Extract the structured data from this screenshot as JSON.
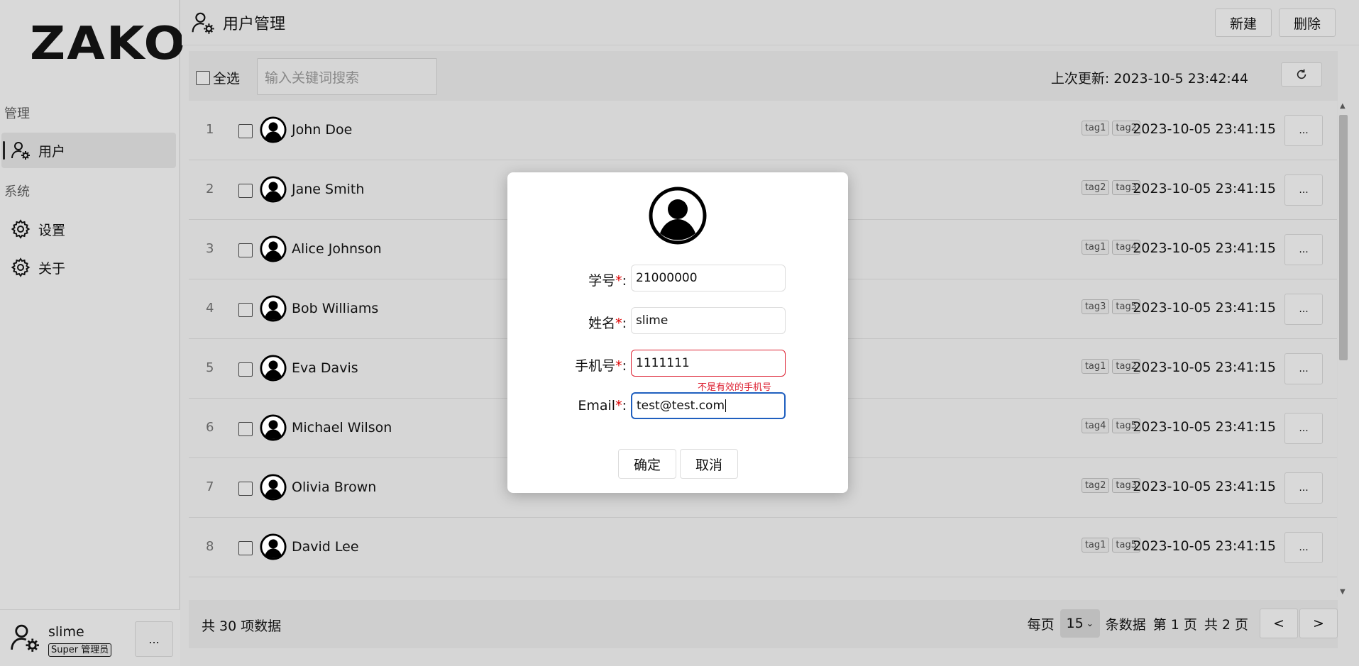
{
  "logo": "ZAKO",
  "sidebar": {
    "sections": [
      {
        "title": "管理",
        "items": [
          {
            "label": "用户",
            "icon": "user-gear-icon",
            "active": true
          }
        ]
      },
      {
        "title": "系统",
        "items": [
          {
            "label": "设置",
            "icon": "gear-icon"
          },
          {
            "label": "关于",
            "icon": "gear-icon"
          }
        ]
      }
    ],
    "user": {
      "name": "slime",
      "role": "Super 管理员",
      "more": "..."
    }
  },
  "header": {
    "title": "用户管理",
    "new_label": "新建",
    "delete_label": "删除"
  },
  "toolbar": {
    "select_all": "全选",
    "search_placeholder": "输入关键词搜索",
    "last_updated": "上次更新: 2023-10-5 23:42:44"
  },
  "rows": [
    {
      "index": "1",
      "name": "John Doe",
      "tags": [
        "tag1",
        "tag2"
      ],
      "date": "2023-10-05 23:41:15"
    },
    {
      "index": "2",
      "name": "Jane Smith",
      "tags": [
        "tag2",
        "tag3"
      ],
      "date": "2023-10-05 23:41:15"
    },
    {
      "index": "3",
      "name": "Alice Johnson",
      "tags": [
        "tag1",
        "tag4"
      ],
      "date": "2023-10-05 23:41:15"
    },
    {
      "index": "4",
      "name": "Bob Williams",
      "tags": [
        "tag3",
        "tag5"
      ],
      "date": "2023-10-05 23:41:15"
    },
    {
      "index": "5",
      "name": "Eva Davis",
      "tags": [
        "tag1",
        "tag2"
      ],
      "date": "2023-10-05 23:41:15"
    },
    {
      "index": "6",
      "name": "Michael Wilson",
      "tags": [
        "tag4",
        "tag5"
      ],
      "date": "2023-10-05 23:41:15"
    },
    {
      "index": "7",
      "name": "Olivia Brown",
      "tags": [
        "tag2",
        "tag3"
      ],
      "date": "2023-10-05 23:41:15"
    },
    {
      "index": "8",
      "name": "David Lee",
      "tags": [
        "tag1",
        "tag5"
      ],
      "date": "2023-10-05 23:41:15"
    }
  ],
  "row_more": "...",
  "footer": {
    "total": "共 30 项数据",
    "per_page_label": "每页",
    "per_page_value": "15",
    "per_page_suffix": "条数据",
    "current_page": "第 1 页",
    "total_pages": "共 2 页",
    "prev": "<",
    "next": ">"
  },
  "dialog": {
    "fields": [
      {
        "label": "学号",
        "required": "*",
        "value": "21000000"
      },
      {
        "label": "姓名",
        "required": "*",
        "value": "slime"
      },
      {
        "label": "手机号",
        "required": "*",
        "value": "1111111",
        "error": "不是有效的手机号"
      },
      {
        "label": "Email",
        "required": "*",
        "value": "test@test.com"
      }
    ],
    "confirm": "确定",
    "cancel": "取消"
  },
  "colors": {
    "error": "#dd2233",
    "focus": "#1f5fbf",
    "required": "#dd0000"
  }
}
